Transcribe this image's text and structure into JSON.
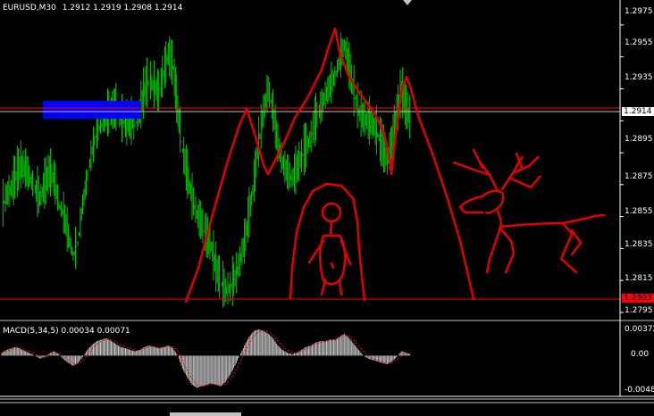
{
  "header": {
    "title": "EURUSD,M30",
    "ohlc": [
      "1.2912",
      "1.2919",
      "1.2908",
      "1.2914"
    ]
  },
  "price_axis": {
    "labels": [
      "1.2975",
      "1.2955",
      "1.2935",
      "1.2915",
      "1.2895",
      "1.2875",
      "1.2855",
      "1.2835",
      "1.2815",
      "1.2795"
    ],
    "current_price_tag": "1.2914",
    "low_line_tag": "1.2803"
  },
  "macd": {
    "title": "MACD(5,34,5) 0.00034 0.00071",
    "axis_labels": [
      "0.00372",
      "0.00",
      "-0.00484"
    ]
  },
  "colors": {
    "background": "#000000",
    "bars": "#00c800",
    "axis": "#ffffff",
    "red_line": "#ff0000",
    "drawing": "#e00000",
    "blue_zone": "#0000ff",
    "macd_hist": "#c0c0c0",
    "macd_signal": "#ff0000"
  },
  "chart_data": {
    "type": "candlestick",
    "symbol": "EURUSD",
    "timeframe": "M30",
    "ylim": [
      1.2795,
      1.2985
    ],
    "current_price": 1.2914,
    "horizontal_lines": [
      1.2918,
      1.2803
    ],
    "blue_zone": [
      1.291,
      1.292
    ],
    "close_series": [
      1.286,
      1.2868,
      1.2872,
      1.288,
      1.2886,
      1.2884,
      1.2878,
      1.2872,
      1.2866,
      1.2874,
      1.2882,
      1.2878,
      1.2862,
      1.2856,
      1.2842,
      1.283,
      1.2838,
      1.2862,
      1.288,
      1.2896,
      1.2908,
      1.2912,
      1.2918,
      1.292,
      1.2922,
      1.2916,
      1.2912,
      1.2914,
      1.2912,
      1.292,
      1.2934,
      1.294,
      1.2936,
      1.2932,
      1.2944,
      1.2956,
      1.2948,
      1.292,
      1.2896,
      1.288,
      1.2866,
      1.2856,
      1.285,
      1.2842,
      1.2836,
      1.2822,
      1.2814,
      1.2808,
      1.281,
      1.2816,
      1.2826,
      1.2838,
      1.2856,
      1.2876,
      1.29,
      1.292,
      1.2934,
      1.292,
      1.29,
      1.2888,
      1.2882,
      1.2878,
      1.2884,
      1.2892,
      1.2898,
      1.2904,
      1.2916,
      1.2922,
      1.293,
      1.2936,
      1.2942,
      1.2952,
      1.2962,
      1.2948,
      1.2932,
      1.292,
      1.2916,
      1.2914,
      1.2912,
      1.2906,
      1.2898,
      1.289,
      1.29,
      1.2918,
      1.2934,
      1.2922,
      1.2914
    ],
    "macd_hist": [
      0.0004,
      0.0008,
      0.001,
      0.0012,
      0.0009,
      0.0006,
      0.0003,
      0.0,
      -0.0004,
      -0.0002,
      0.0003,
      0.0006,
      0.0002,
      -0.0005,
      -0.001,
      -0.0014,
      -0.001,
      -0.0002,
      0.0008,
      0.0015,
      0.002,
      0.0022,
      0.0024,
      0.002,
      0.0016,
      0.0012,
      0.001,
      0.0008,
      0.0006,
      0.0008,
      0.0012,
      0.0014,
      0.0012,
      0.001,
      0.0012,
      0.0014,
      0.001,
      0.0,
      -0.0018,
      -0.003,
      -0.004,
      -0.0044,
      -0.0042,
      -0.004,
      -0.0038,
      -0.004,
      -0.0042,
      -0.0036,
      -0.0026,
      -0.0014,
      0.0,
      0.0014,
      0.0026,
      0.0034,
      0.0036,
      0.0034,
      0.003,
      0.0024,
      0.0014,
      0.0008,
      0.0004,
      0.0002,
      0.0004,
      0.0008,
      0.0012,
      0.0014,
      0.0018,
      0.002,
      0.002,
      0.0022,
      0.0022,
      0.0026,
      0.003,
      0.0024,
      0.0016,
      0.0008,
      0.0,
      -0.0004,
      -0.0006,
      -0.0008,
      -0.001,
      -0.0012,
      -0.0008,
      -0.0002,
      0.0006,
      0.0004,
      0.0002
    ],
    "macd_ylim": [
      -0.00484,
      0.00372
    ]
  }
}
